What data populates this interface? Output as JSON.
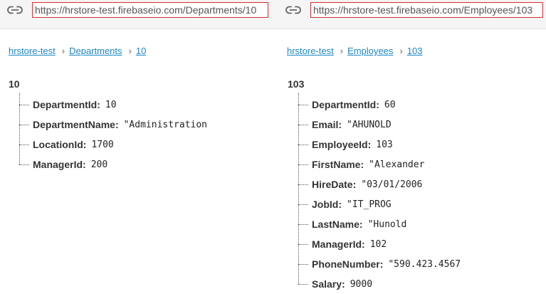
{
  "left": {
    "url": "https://hrstore-test.firebaseio.com/Departments/10",
    "breadcrumb": [
      "hrstore-test",
      "Departments",
      "10"
    ],
    "root": "10",
    "fields": [
      {
        "key": "DepartmentId",
        "value": "10"
      },
      {
        "key": "DepartmentName",
        "value": "\"Administration"
      },
      {
        "key": "LocationId",
        "value": "1700"
      },
      {
        "key": "ManagerId",
        "value": "200"
      }
    ]
  },
  "right": {
    "url": "https://hrstore-test.firebaseio.com/Employees/103",
    "breadcrumb": [
      "hrstore-test",
      "Employees",
      "103"
    ],
    "root": "103",
    "fields": [
      {
        "key": "DepartmentId",
        "value": "60"
      },
      {
        "key": "Email",
        "value": "\"AHUNOLD"
      },
      {
        "key": "EmployeeId",
        "value": "103"
      },
      {
        "key": "FirstName",
        "value": "\"Alexander"
      },
      {
        "key": "HireDate",
        "value": "\"03/01/2006"
      },
      {
        "key": "JobId",
        "value": "\"IT_PROG"
      },
      {
        "key": "LastName",
        "value": "\"Hunold"
      },
      {
        "key": "ManagerId",
        "value": "102"
      },
      {
        "key": "PhoneNumber",
        "value": "\"590.423.4567"
      },
      {
        "key": "Salary",
        "value": "9000"
      }
    ]
  },
  "icon": "link-icon"
}
